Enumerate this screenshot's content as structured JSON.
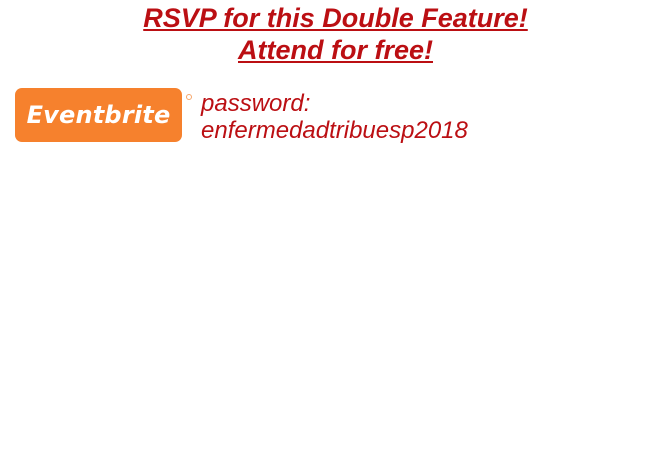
{
  "rsvp": {
    "line1": "RSVP for this Double Feature!",
    "line2": "Attend for free!"
  },
  "logo": {
    "text": "Eventbrite",
    "color": "#f6812d",
    "icon": "eventbrite-logo"
  },
  "password": {
    "label": "password:",
    "value": "enfermedadtribuesp2018"
  },
  "colors": {
    "accent": "#bb0f13",
    "background": "#ffffff"
  }
}
